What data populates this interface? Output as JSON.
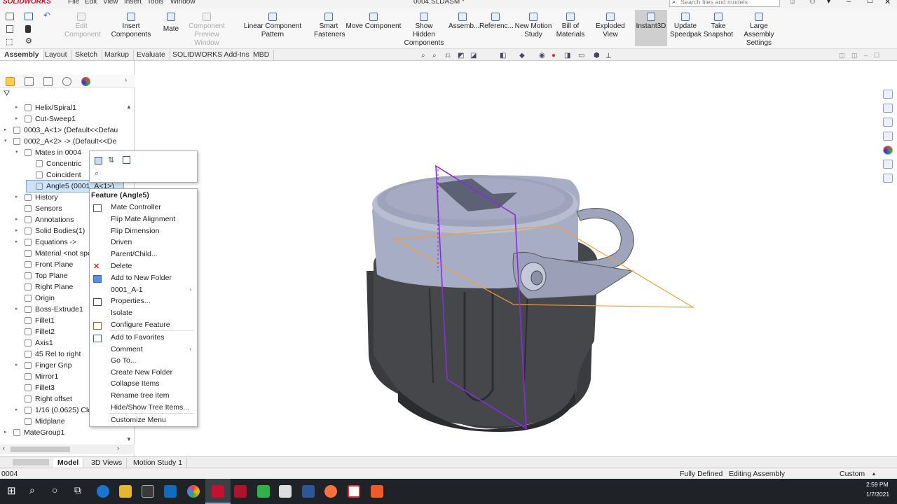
{
  "titlebar": {
    "app": "SOLIDWORKS",
    "menus": [
      "File",
      "Edit",
      "View",
      "Insert",
      "Tools",
      "Window"
    ],
    "doc_title": "0004.SLDASM *",
    "search_placeholder": "Search files and models"
  },
  "ribbon": {
    "buttons": [
      {
        "label1": "Edit",
        "label2": "Component",
        "disabled": true
      },
      {
        "label1": "Insert Components",
        "label2": "",
        "disabled": false
      },
      {
        "label1": "Mate",
        "label2": "",
        "disabled": false
      },
      {
        "label1": "Component",
        "label2": "Preview Window",
        "disabled": true
      },
      {
        "label1": "Linear Component Pattern",
        "label2": "",
        "disabled": false
      },
      {
        "label1": "Smart",
        "label2": "Fasteners",
        "disabled": false
      },
      {
        "label1": "Move Component",
        "label2": "",
        "disabled": false
      },
      {
        "label1": "Show Hidden",
        "label2": "Components",
        "disabled": false
      },
      {
        "label1": "Assemb...",
        "label2": "",
        "disabled": false
      },
      {
        "label1": "Referenc...",
        "label2": "",
        "disabled": false
      },
      {
        "label1": "New Motion",
        "label2": "Study",
        "disabled": false
      },
      {
        "label1": "Bill of",
        "label2": "Materials",
        "disabled": false
      },
      {
        "label1": "Exploded View",
        "label2": "",
        "disabled": false
      },
      {
        "label1": "Instant3D",
        "label2": "",
        "disabled": false
      },
      {
        "label1": "Update",
        "label2": "Speedpak",
        "disabled": false
      },
      {
        "label1": "Take",
        "label2": "Snapshot",
        "disabled": false
      },
      {
        "label1": "Large Assembly",
        "label2": "Settings",
        "disabled": false
      }
    ]
  },
  "cmd_tabs": [
    "Assembly",
    "Layout",
    "Sketch",
    "Markup",
    "Evaluate",
    "SOLIDWORKS Add-Ins",
    "MBD"
  ],
  "tree": [
    {
      "label": "Helix/Spiral1",
      "indent": 1,
      "arrow": "▸"
    },
    {
      "label": "Cut-Sweep1",
      "indent": 1,
      "arrow": "▸"
    },
    {
      "label": "0003_A<1> (Default<<Defau",
      "indent": 0,
      "arrow": "▸"
    },
    {
      "label": "0002_A<2> -> (Default<<De",
      "indent": 0,
      "arrow": "▾"
    },
    {
      "label": "Mates in 0004",
      "indent": 1,
      "arrow": "▾"
    },
    {
      "label": "Concentric",
      "indent": 2,
      "arrow": ""
    },
    {
      "label": "Coincident",
      "indent": 2,
      "arrow": ""
    },
    {
      "label": "Angle5 (0001_A<1>)",
      "indent": 2,
      "arrow": "",
      "selected": true
    },
    {
      "label": "History",
      "indent": 1,
      "arrow": "▸"
    },
    {
      "label": "Sensors",
      "indent": 1,
      "arrow": ""
    },
    {
      "label": "Annotations",
      "indent": 1,
      "arrow": "▸"
    },
    {
      "label": "Solid Bodies(1)",
      "indent": 1,
      "arrow": "▸"
    },
    {
      "label": "Equations ->",
      "indent": 1,
      "arrow": "▸"
    },
    {
      "label": "Material <not spe",
      "indent": 1,
      "arrow": ""
    },
    {
      "label": "Front Plane",
      "indent": 1,
      "arrow": ""
    },
    {
      "label": "Top Plane",
      "indent": 1,
      "arrow": ""
    },
    {
      "label": "Right Plane",
      "indent": 1,
      "arrow": ""
    },
    {
      "label": "Origin",
      "indent": 1,
      "arrow": ""
    },
    {
      "label": "Boss-Extrude1",
      "indent": 1,
      "arrow": "▸"
    },
    {
      "label": "Fillet1",
      "indent": 1,
      "arrow": ""
    },
    {
      "label": "Fillet2",
      "indent": 1,
      "arrow": ""
    },
    {
      "label": "Axis1",
      "indent": 1,
      "arrow": ""
    },
    {
      "label": "45 Rel to right",
      "indent": 1,
      "arrow": ""
    },
    {
      "label": "Finger Grip",
      "indent": 1,
      "arrow": "▸"
    },
    {
      "label": "Mirror1",
      "indent": 1,
      "arrow": ""
    },
    {
      "label": "Fillet3",
      "indent": 1,
      "arrow": ""
    },
    {
      "label": "Right offset",
      "indent": 1,
      "arrow": ""
    },
    {
      "label": "1/16 (0.0625) Clea",
      "indent": 1,
      "arrow": "▸"
    },
    {
      "label": "Midplane",
      "indent": 1,
      "arrow": ""
    },
    {
      "label": "MateGroup1",
      "indent": 0,
      "arrow": "▸"
    }
  ],
  "context_menu": {
    "title": "Feature (Angle5)",
    "items": [
      {
        "label": "Mate Controller",
        "icon": "mate-controller-icon",
        "submenu": false
      },
      {
        "label": "Flip Mate Alignment",
        "icon": "",
        "submenu": false
      },
      {
        "label": "Flip Dimension",
        "icon": "",
        "submenu": false
      },
      {
        "label": "Driven",
        "icon": "",
        "submenu": false
      },
      {
        "label": "Parent/Child...",
        "icon": "",
        "submenu": false
      },
      {
        "label": "Delete",
        "icon": "delete-icon",
        "submenu": false
      },
      {
        "label": "Add to New Folder",
        "icon": "folder-icon",
        "submenu": false
      },
      {
        "label": "0001_A-1",
        "icon": "",
        "submenu": true
      },
      {
        "label": "Properties...",
        "icon": "properties-icon",
        "submenu": false
      },
      {
        "label": "Isolate",
        "icon": "",
        "submenu": false
      },
      {
        "label": "Configure Feature",
        "icon": "configure-icon",
        "submenu": false
      },
      {
        "label": "Add to Favorites",
        "icon": "favorites-icon",
        "submenu": false
      },
      {
        "label": "Comment",
        "icon": "",
        "submenu": true
      },
      {
        "label": "Go To...",
        "icon": "",
        "submenu": false
      },
      {
        "label": "Create New Folder",
        "icon": "",
        "submenu": false
      },
      {
        "label": "Collapse Items",
        "icon": "",
        "submenu": false
      },
      {
        "label": "Rename tree item",
        "icon": "",
        "submenu": false
      },
      {
        "label": "Hide/Show Tree Items...",
        "icon": "",
        "submenu": false
      },
      {
        "label": "Customize Menu",
        "icon": "",
        "submenu": false
      }
    ]
  },
  "bottom_tabs": [
    "Model",
    "3D Views",
    "Motion Study 1"
  ],
  "status": {
    "left": "0004",
    "defined": "Fully Defined",
    "mode": "Editing Assembly",
    "units": "Custom"
  },
  "clock": {
    "time": "2:59 PM",
    "date": "1/7/2021"
  },
  "colors": {
    "accent": "#c8102e",
    "selection": "#cde3f7",
    "plane_purple": "#8a2be2",
    "plane_orange": "#f0a030",
    "body_dark": "#3c3d40",
    "body_light": "#a9aec8"
  }
}
